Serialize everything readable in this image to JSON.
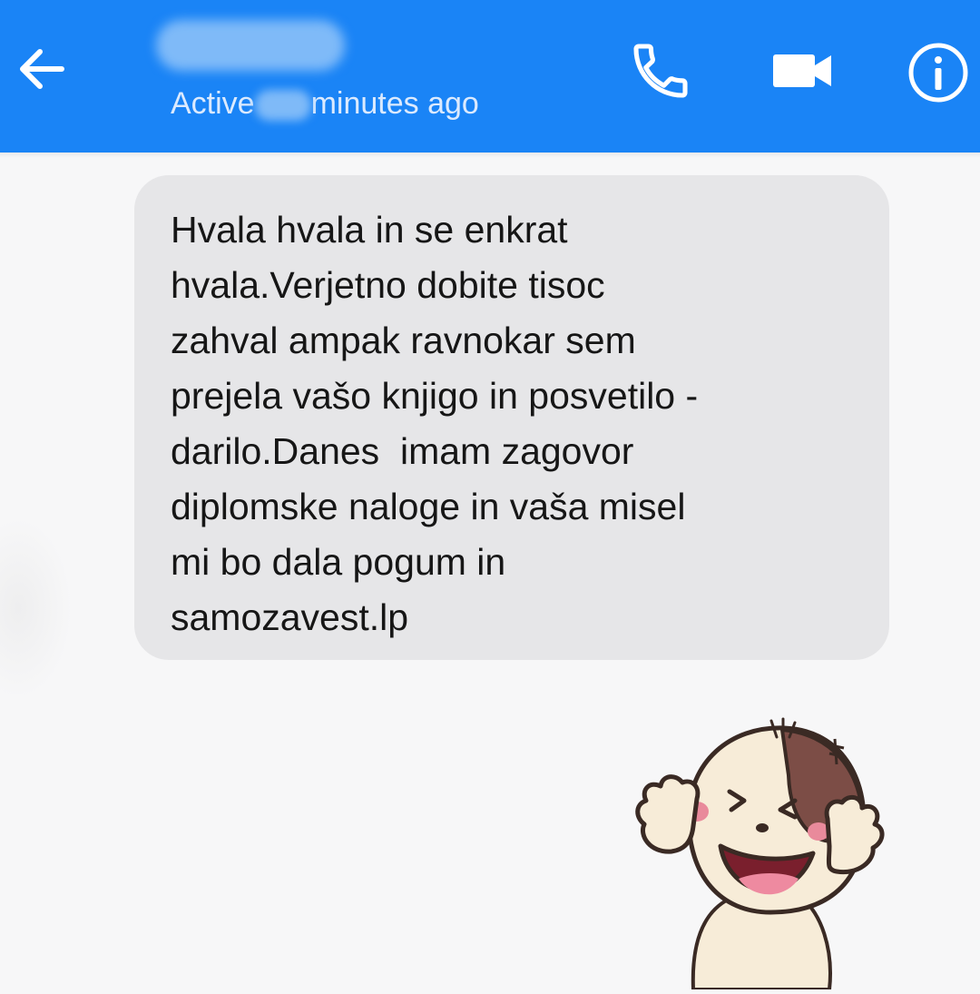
{
  "header": {
    "contact_name": "",
    "status_prefix": "Active",
    "status_suffix": "minutes ago",
    "bg_color": "#1a84f6",
    "icons": [
      "back-arrow-icon",
      "phone-icon",
      "video-camera-icon",
      "info-icon"
    ]
  },
  "messages": [
    {
      "direction": "incoming",
      "text": "Hvala hvala in se enkrat\nhvala.Verjetno dobite tisoc\nzahval ampak ravnokar sem\nprejela vašo knjigo in posvetilo -\ndarilo.Danes  imam zagovor\ndiplomske naloge in vaša misel\nmi bo dala pogum in\nsamozavest.lp",
      "bubble_color": "#e6e6e8"
    },
    {
      "direction": "outgoing",
      "type": "sticker",
      "sticker": "laughing-dog-sticker"
    }
  ]
}
